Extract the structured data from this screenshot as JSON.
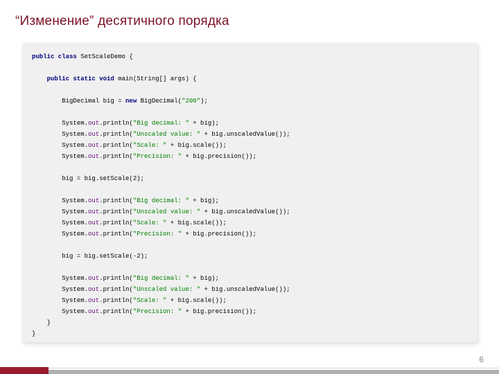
{
  "title": "“Изменение” десятичного порядка",
  "page_number": "6",
  "code": {
    "l00a": "public class",
    "l00b": " SetScaleDemo {",
    "l01": "",
    "l02a": "    public static void",
    "l02b": " main(String[] args) {",
    "l03": "",
    "l04a": "        BigDecimal big = ",
    "l04b": "new",
    "l04c": " BigDecimal(",
    "l04d": "\"200\"",
    "l04e": ");",
    "l05": "",
    "l06a": "        System.",
    "l06b": "out",
    "l06c": ".println(",
    "l06d": "\"Big decimal: \"",
    "l06e": " + big);",
    "l07a": "        System.",
    "l07b": "out",
    "l07c": ".println(",
    "l07d": "\"Unscaled value: \"",
    "l07e": " + big.unscaledValue());",
    "l08a": "        System.",
    "l08b": "out",
    "l08c": ".println(",
    "l08d": "\"Scale: \"",
    "l08e": " + big.scale());",
    "l09a": "        System.",
    "l09b": "out",
    "l09c": ".println(",
    "l09d": "\"Precision: \"",
    "l09e": " + big.precision());",
    "l10": "",
    "l11a": "        big = big.setScale(",
    "l11b": "2",
    "l11c": ");",
    "l12": "",
    "l13a": "        System.",
    "l13b": "out",
    "l13c": ".println(",
    "l13d": "\"Big decimal: \"",
    "l13e": " + big);",
    "l14a": "        System.",
    "l14b": "out",
    "l14c": ".println(",
    "l14d": "\"Unscaled value: \"",
    "l14e": " + big.unscaledValue());",
    "l15a": "        System.",
    "l15b": "out",
    "l15c": ".println(",
    "l15d": "\"Scale: \"",
    "l15e": " + big.scale());",
    "l16a": "        System.",
    "l16b": "out",
    "l16c": ".println(",
    "l16d": "\"Precision: \"",
    "l16e": " + big.precision());",
    "l17": "",
    "l18a": "        big = big.setScale(-",
    "l18b": "2",
    "l18c": ");",
    "l19": "",
    "l20a": "        System.",
    "l20b": "out",
    "l20c": ".println(",
    "l20d": "\"Big decimal: \"",
    "l20e": " + big);",
    "l21a": "        System.",
    "l21b": "out",
    "l21c": ".println(",
    "l21d": "\"Unscaled value: \"",
    "l21e": " + big.unscaledValue());",
    "l22a": "        System.",
    "l22b": "out",
    "l22c": ".println(",
    "l22d": "\"Scale: \"",
    "l22e": " + big.scale());",
    "l23a": "        System.",
    "l23b": "out",
    "l23c": ".println(",
    "l23d": "\"Precision: \"",
    "l23e": " + big.precision());",
    "l24": "    }",
    "l25": "}"
  }
}
